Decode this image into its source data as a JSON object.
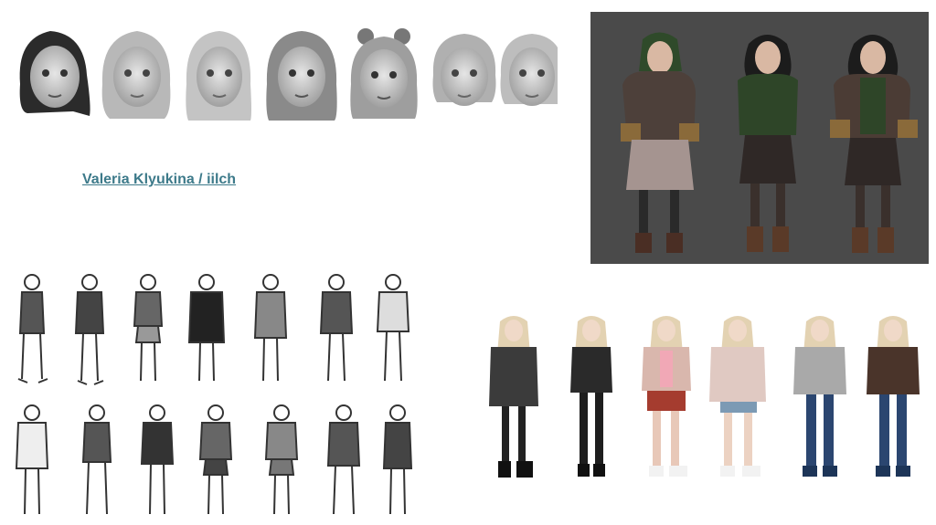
{
  "credit": {
    "label": "Valeria Klyukina / iilch"
  },
  "colors": {
    "credit_link": "#3d7a8a",
    "portrait_backdrop": "#4a4a4a"
  },
  "artwork": {
    "head_sketches_count": 7,
    "portrait_figures_count": 3,
    "sketch_figures_rows": 2,
    "sketch_figures_per_row": 7,
    "color_figures_count": 6
  }
}
